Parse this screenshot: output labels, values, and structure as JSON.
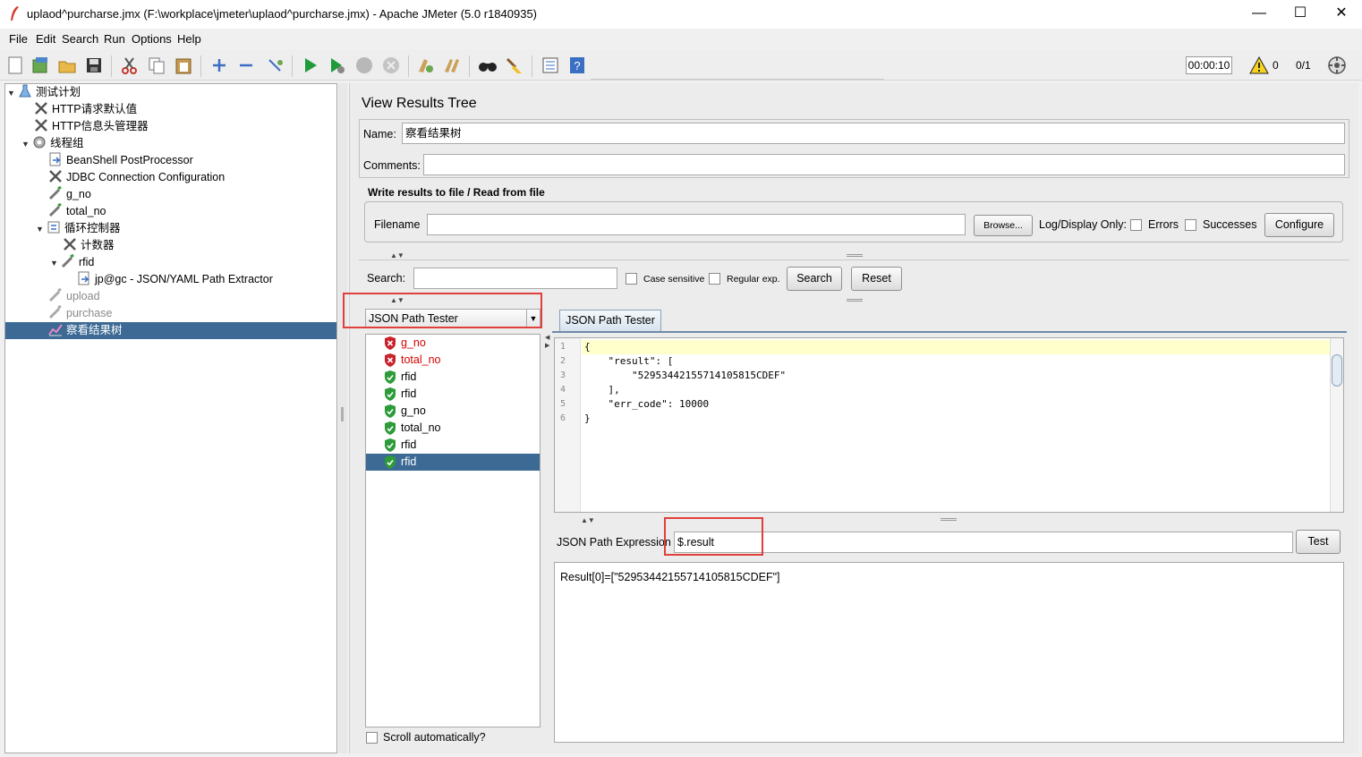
{
  "window": {
    "title": "uplaod^purcharse.jmx (F:\\workplace\\jmeter\\uplaod^purcharse.jmx) - Apache JMeter (5.0 r1840935)",
    "minimize": "—",
    "maximize": "☐",
    "close": "✕"
  },
  "menu": {
    "file": "File",
    "edit": "Edit",
    "search": "Search",
    "run": "Run",
    "options": "Options",
    "help": "Help"
  },
  "toolbar": {
    "timer": "00:00:10",
    "warning_count": "0",
    "thread_ratio": "0/1"
  },
  "tree": {
    "root": "测试计划",
    "http_defaults": "HTTP请求默认值",
    "header_manager": "HTTP信息头管理器",
    "thread_group": "线程组",
    "beanshell": "BeanShell PostProcessor",
    "jdbc": "JDBC Connection Configuration",
    "g_no": "g_no",
    "total_no": "total_no",
    "loop": "循环控制器",
    "counter": "计数器",
    "rfid": "rfid",
    "extractor": "jp@gc - JSON/YAML Path Extractor",
    "upload": "upload",
    "purchase": "purchase",
    "results_tree": "察看结果树"
  },
  "panel": {
    "heading": "View Results Tree",
    "name_label": "Name:",
    "name_value": "察看结果树",
    "comments_label": "Comments:",
    "comments_value": "",
    "write_results_label": "Write results to file / Read from file",
    "filename_label": "Filename",
    "filename_value": "",
    "browse_button": "Browse...",
    "log_display_label": "Log/Display Only:",
    "errors_label": "Errors",
    "successes_label": "Successes",
    "configure_button": "Configure",
    "search_label": "Search:",
    "search_value": "",
    "case_sensitive_label": "Case sensitive",
    "regular_exp_label": "Regular exp.",
    "search_button": "Search",
    "reset_button": "Reset",
    "renderer_select": "JSON Path Tester",
    "scroll_auto_label": "Scroll automatically?",
    "tester_tab": "JSON Path Tester",
    "json_path_label": "JSON Path Expression",
    "json_path_value": "$.result",
    "test_button": "Test",
    "result_text": "Result[0]=[\"52953442155714105815CDEF\"]"
  },
  "samples": [
    {
      "label": "g_no",
      "status": "error"
    },
    {
      "label": "total_no",
      "status": "error"
    },
    {
      "label": "rfid",
      "status": "ok"
    },
    {
      "label": "rfid",
      "status": "ok"
    },
    {
      "label": "g_no",
      "status": "ok"
    },
    {
      "label": "total_no",
      "status": "ok"
    },
    {
      "label": "rfid",
      "status": "ok"
    },
    {
      "label": "rfid",
      "status": "ok"
    }
  ],
  "code_lines": [
    {
      "num": "1",
      "text": "{"
    },
    {
      "num": "2",
      "text": "    \"result\": ["
    },
    {
      "num": "3",
      "text": "        \"52953442155714105815CDEF\""
    },
    {
      "num": "4",
      "text": "    ],"
    },
    {
      "num": "5",
      "text": "    \"err_code\": 10000"
    },
    {
      "num": "6",
      "text": "}"
    }
  ],
  "colors": {
    "selection": "#3c6a94",
    "highlight_box": "#e0403c",
    "code_highlight": "#ffffcc",
    "error_icon": "#c8232c",
    "ok_icon": "#2e9b3a"
  }
}
